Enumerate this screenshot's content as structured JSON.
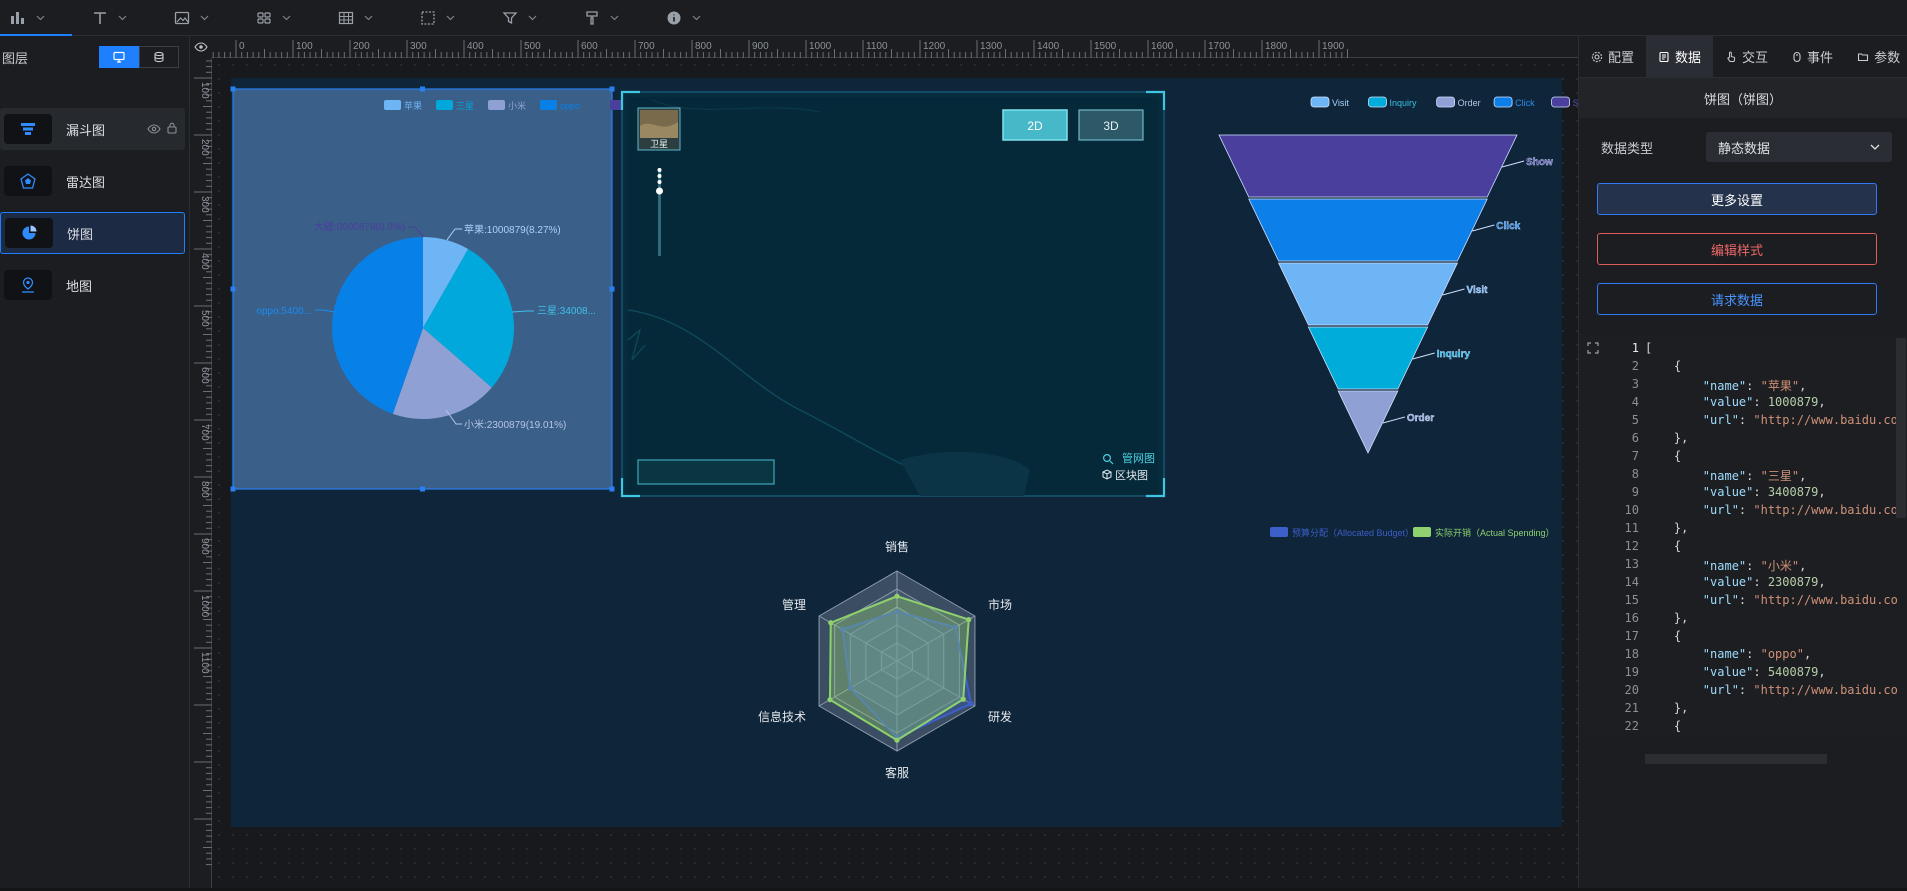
{
  "toolbar": {
    "tools": [
      {
        "name": "chart-icon",
        "x": 10
      },
      {
        "name": "text-icon",
        "x": 92
      },
      {
        "name": "image-icon",
        "x": 174
      },
      {
        "name": "grid-icon",
        "x": 256
      },
      {
        "name": "table-icon",
        "x": 338
      },
      {
        "name": "selection-icon",
        "x": 420
      },
      {
        "name": "filter-icon",
        "x": 502
      },
      {
        "name": "paint-icon",
        "x": 584
      },
      {
        "name": "info-icon",
        "x": 666
      }
    ]
  },
  "layers_panel": {
    "title": "图层",
    "items": [
      {
        "label": "漏斗图",
        "icon": "funnel-icon",
        "state": "hover"
      },
      {
        "label": "雷达图",
        "icon": "radar-icon",
        "state": ""
      },
      {
        "label": "饼图",
        "icon": "pie-icon",
        "state": "selected"
      },
      {
        "label": "地图",
        "icon": "map-icon",
        "state": ""
      }
    ]
  },
  "ruler": {
    "h_labels": [
      "0",
      "100",
      "200",
      "300",
      "400",
      "500",
      "600",
      "700",
      "800",
      "900",
      "1000",
      "1100",
      "1200",
      "1300",
      "1400",
      "1500",
      "1600",
      "1700",
      "1800",
      "1900"
    ],
    "v_labels": [
      "100",
      "200",
      "300",
      "400",
      "500",
      "600",
      "700",
      "800",
      "900",
      "1000",
      "1100"
    ]
  },
  "right_panel": {
    "tabs": [
      "配置",
      "数据",
      "交互",
      "事件",
      "参数"
    ],
    "active_tab": "数据",
    "subtitle": "饼图（饼图）",
    "data_type_label": "数据类型",
    "data_type_value": "静态数据",
    "more_settings": "更多设置",
    "edit_style": "编辑样式",
    "request_data": "请求数据",
    "code_lines": [
      "[",
      "    {",
      "        \"name\": \"苹果\",",
      "        \"value\": 1000879,",
      "        \"url\": \"http://www.baidu.co",
      "    },",
      "    {",
      "        \"name\": \"三星\",",
      "        \"value\": 3400879,",
      "        \"url\": \"http://www.baidu.co",
      "    },",
      "    {",
      "        \"name\": \"小米\",",
      "        \"value\": 2300879,",
      "        \"url\": \"http://www.baidu.co",
      "    },",
      "    {",
      "        \"name\": \"oppo\",",
      "        \"value\": 5400879,",
      "        \"url\": \"http://www.baidu.co",
      "    },",
      "    {"
    ]
  },
  "map_widget": {
    "satellite_label": "卫星",
    "btn_2d": "2D",
    "btn_3d": "3D",
    "legend_pipe": "管网图",
    "legend_block": "区块图"
  },
  "chart_data": [
    {
      "type": "pie",
      "legend": [
        "苹果",
        "三星",
        "小米",
        "oppo",
        "大疆"
      ],
      "labels": [
        "苹果:1000879(8.27%)",
        "三星:34008...",
        "小米:2300879(19.01%)",
        "oppo:5400...",
        "大疆:0000879(0.0%)"
      ],
      "slices": [
        {
          "name": "苹果",
          "value": 1000879,
          "color": "#6eb5f5"
        },
        {
          "name": "三星",
          "value": 3400879,
          "color": "#00a8dc"
        },
        {
          "name": "小米",
          "value": 2300879,
          "color": "#8fa1d4"
        },
        {
          "name": "oppo",
          "value": 5400879,
          "color": "#0780e8"
        }
      ]
    },
    {
      "type": "funnel",
      "legend": [
        "Visit",
        "Inquiry",
        "Order",
        "Click",
        "Show"
      ],
      "stages": [
        {
          "name": "Show",
          "value": 100,
          "color": "#4b3f9e"
        },
        {
          "name": "Click",
          "value": 80,
          "color": "#0d7fe8"
        },
        {
          "name": "Visit",
          "value": 60,
          "color": "#6eb5f5"
        },
        {
          "name": "Inquiry",
          "value": 40,
          "color": "#00acd9"
        },
        {
          "name": "Order",
          "value": 20,
          "color": "#8fa1d4"
        }
      ]
    },
    {
      "type": "radar",
      "legend": [
        "预算分配（Allocated Budget）",
        "实际开销（Actual Spending）"
      ],
      "indicators": [
        "销售",
        "市场",
        "研发",
        "客服",
        "信息技术",
        "管理"
      ],
      "series": [
        {
          "name": "预算分配（Allocated Budget）",
          "values": [
            0.55,
            0.75,
            0.95,
            0.85,
            0.6,
            0.7
          ],
          "color": "#3d5fc9"
        },
        {
          "name": "实际开销（Actual Spending）",
          "values": [
            0.72,
            0.92,
            0.85,
            0.88,
            0.86,
            0.85
          ],
          "color": "#8fd16e"
        }
      ]
    }
  ]
}
